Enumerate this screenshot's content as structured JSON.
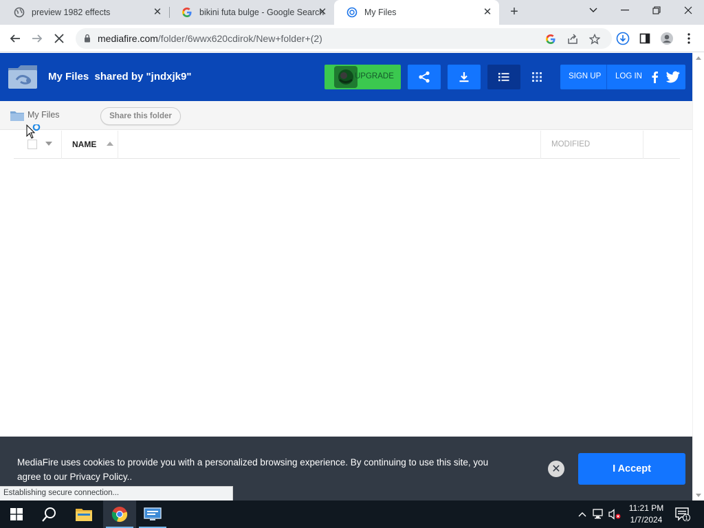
{
  "browser": {
    "tabs": [
      {
        "title": "preview 1982 effects",
        "active": false
      },
      {
        "title": "bikini futa bulge - Google Search",
        "active": false
      },
      {
        "title": "My Files",
        "active": true
      }
    ],
    "url_host": "mediafire.com",
    "url_path": "/folder/6wwx620cdirok/New+folder+(2)",
    "status_text": "Establishing secure connection..."
  },
  "header": {
    "title": "My Files",
    "shared_by": "shared by \"jndxjk9\"",
    "upgrade_label": "UPGRADE",
    "signup_label": "SIGN UP",
    "login_label": "LOG IN",
    "accent": "#0a47b7",
    "button_color": "#1375ff",
    "upgrade_color": "#3bc84f"
  },
  "breadcrumb": {
    "label": "My Files",
    "share_label": "Share this folder"
  },
  "file_list": {
    "columns": [
      "NAME",
      "MODIFIED"
    ],
    "rows": []
  },
  "cookie_banner": {
    "text": "MediaFire uses cookies to provide you with a personalized browsing experience. By continuing to use this site, you agree to our Privacy Policy..",
    "accept_label": "I Accept"
  },
  "taskbar": {
    "time": "11:21 PM",
    "date": "1/7/2024",
    "notification_count": "1"
  },
  "icons": [
    "globe-icon",
    "google-icon",
    "mediafire-icon",
    "lock-icon",
    "share-icon",
    "download-icon",
    "list-view-icon",
    "grid-view-icon",
    "facebook-icon",
    "twitter-icon",
    "folder-icon",
    "windows-icon",
    "search-icon",
    "file-explorer-icon",
    "chrome-icon"
  ]
}
